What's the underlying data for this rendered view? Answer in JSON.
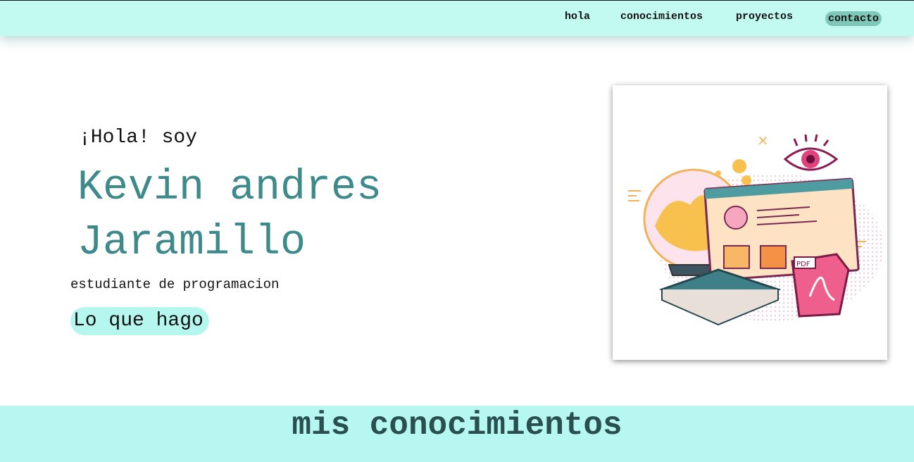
{
  "nav": {
    "items": [
      {
        "label": "hola"
      },
      {
        "label": "conocimientos"
      },
      {
        "label": "proyectos"
      },
      {
        "label": "contacto"
      }
    ]
  },
  "hero": {
    "greeting": "¡Hola! soy",
    "name_line1": "Kevin andres",
    "name_line2": "Jaramillo",
    "subtitle": "estudiante de programacion",
    "cta_label": "Lo que hago",
    "illustration_pdf_label": "PDF"
  },
  "section": {
    "title": "mis conocimientos"
  },
  "colors": {
    "nav_bg": "#c2faef",
    "accent_teal": "#3e8a8a",
    "cta_bg": "#b5f7ef",
    "section_bg": "#b6f7f1",
    "contact_pill": "#7fc8b7"
  }
}
